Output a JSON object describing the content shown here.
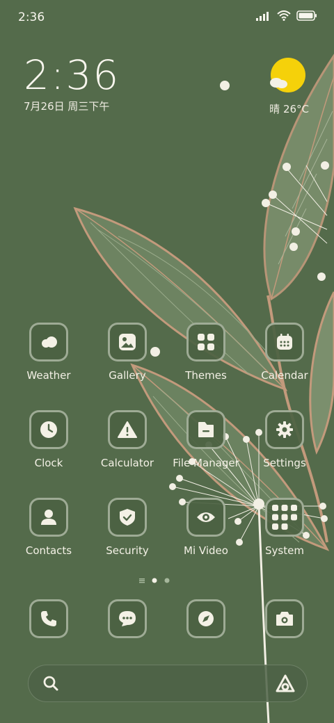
{
  "status_bar": {
    "time": "2:36"
  },
  "clock_widget": {
    "time": "2:36",
    "date": "7月26日 周三下午"
  },
  "weather_widget": {
    "condition": "晴",
    "temperature": "26°C",
    "icon": "sunny-partly-cloudy-icon"
  },
  "apps": [
    {
      "label": "Weather",
      "icon": "weather-icon"
    },
    {
      "label": "Gallery",
      "icon": "gallery-icon"
    },
    {
      "label": "Themes",
      "icon": "themes-icon"
    },
    {
      "label": "Calendar",
      "icon": "calendar-icon"
    },
    {
      "label": "Clock",
      "icon": "clock-icon"
    },
    {
      "label": "Calculator",
      "icon": "calculator-icon"
    },
    {
      "label": "File Manager",
      "icon": "file-manager-icon"
    },
    {
      "label": "Settings",
      "icon": "settings-icon"
    },
    {
      "label": "Contacts",
      "icon": "contacts-icon"
    },
    {
      "label": "Security",
      "icon": "security-icon"
    },
    {
      "label": "Mi Video",
      "icon": "mi-video-icon"
    },
    {
      "label": "System",
      "icon": "system-folder-icon"
    }
  ],
  "pager": {
    "pages": 2,
    "current": 1
  },
  "dock": [
    {
      "icon": "phone-icon"
    },
    {
      "icon": "messages-icon"
    },
    {
      "icon": "browser-icon"
    },
    {
      "icon": "camera-icon"
    }
  ],
  "search": {
    "placeholder": ""
  },
  "colors": {
    "background": "#546b4b",
    "accent_sun": "#f5d10a",
    "text": "#f4f1e6"
  }
}
